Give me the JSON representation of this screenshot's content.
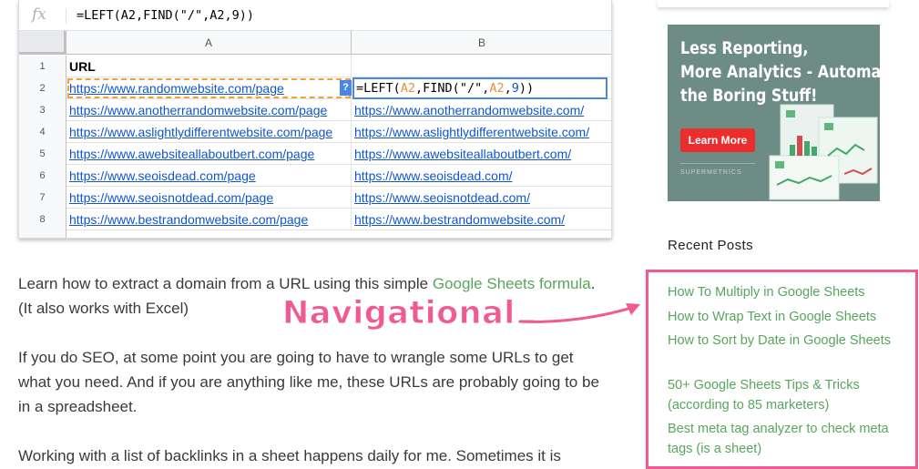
{
  "sheet": {
    "fx_label": "fx",
    "formula": "=LEFT(A2,FIND(\"/\",A2,9))",
    "columns": [
      "A",
      "B"
    ],
    "rows": [
      {
        "num": "1",
        "a": "URL",
        "b": ""
      },
      {
        "num": "2",
        "a": "https://www.randomwebsite.com/page",
        "b": ""
      },
      {
        "num": "3",
        "a": "https://www.anotherrandomwebsite.com/page",
        "b": "https://www.anotherrandomwebsite.com/"
      },
      {
        "num": "4",
        "a": "https://www.aslightlydifferentwebsite.com/page",
        "b": "https://www.aslightlydifferentwebsite.com/"
      },
      {
        "num": "5",
        "a": "https://www.awebsiteallaboutbert.com/page",
        "b": "https://www.awebsiteallaboutbert.com/"
      },
      {
        "num": "6",
        "a": "https://www.seoisdead.com/page",
        "b": "https://www.seoisdead.com/"
      },
      {
        "num": "7",
        "a": "https://www.seoisnotdead.com/page",
        "b": "https://www.seoisnotdead.com/"
      },
      {
        "num": "8",
        "a": "https://www.bestrandomwebsite.com/page",
        "b": "https://www.bestrandomwebsite.com/"
      }
    ],
    "help_badge": "?",
    "edit_parts": [
      "=LEFT(",
      "A2",
      ",FIND(\"/\",",
      "A2",
      ",",
      "9",
      "))"
    ]
  },
  "article": {
    "p1_before": "Learn how to extract a domain from a URL using this simple ",
    "p1_link": "Google Sheets formula",
    "p1_after": ". (It also works with Excel)",
    "p2": "If you do SEO, at some point you are going to have to wrangle some URLs to get what you need. And if you are anything like me, these URLs are probably going to be in a spreadsheet.",
    "p3": "Working with a list of backlinks in a sheet happens daily for me. Sometimes it is"
  },
  "annotation": {
    "label": "Navigational",
    "color": "#ef5a93"
  },
  "ad": {
    "line1": "Less Reporting,",
    "line2": "More Analytics - Automate",
    "line3": "the Boring Stuff!",
    "button": "Learn More",
    "brand": "SUPERMETRICS"
  },
  "sidebar": {
    "recent_title": "Recent Posts",
    "posts": [
      "How To Multiply in Google Sheets",
      "How to Wrap Text in Google Sheets",
      "How to Sort by Date in Google Sheets",
      "50+ Google Sheets Tips & Tricks (according to 85 marketers)",
      "Best meta tag analyzer to check meta tags (is a sheet)"
    ]
  },
  "colors": {
    "link_green": "#58a55c",
    "sheet_link": "#1155cc",
    "highlight_pink": "#ef5a93",
    "ad_bg": "#6e8c86",
    "ad_button": "#ea2e2e"
  }
}
